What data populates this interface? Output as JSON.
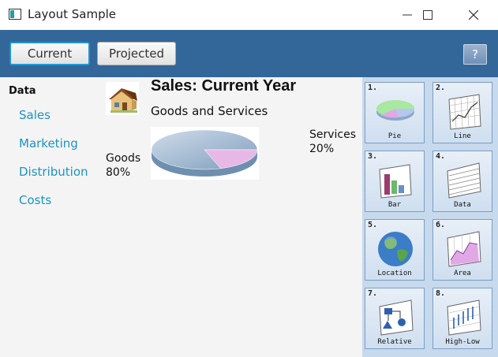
{
  "window": {
    "title": "Layout Sample"
  },
  "toolbar": {
    "current_label": "Current",
    "projected_label": "Projected",
    "help_label": "?"
  },
  "sidebar": {
    "title": "Data",
    "items": [
      {
        "label": "Sales"
      },
      {
        "label": "Marketing"
      },
      {
        "label": "Distribution"
      },
      {
        "label": "Costs"
      }
    ]
  },
  "main": {
    "title": "Sales:  Current Year",
    "subtitle": "Goods and Services"
  },
  "chart_data": {
    "type": "pie",
    "categories": [
      "Goods",
      "Services"
    ],
    "values": [
      80,
      20
    ],
    "labels": [
      {
        "line1": "Goods",
        "line2": "80%"
      },
      {
        "line1": "Services",
        "line2": "20%"
      }
    ],
    "colors": [
      "#a9c1d8",
      "#e7b8e6"
    ]
  },
  "tiles": [
    {
      "number": "1.",
      "label": "Pie"
    },
    {
      "number": "2.",
      "label": "Line"
    },
    {
      "number": "3.",
      "label": "Bar"
    },
    {
      "number": "4.",
      "label": "Data"
    },
    {
      "number": "5.",
      "label": "Location"
    },
    {
      "number": "6.",
      "label": "Area"
    },
    {
      "number": "7.",
      "label": "Relative"
    },
    {
      "number": "8.",
      "label": "High-Low"
    }
  ],
  "icons": {
    "window": "app-window-icon",
    "house": "house-icon",
    "minimize": "minimize-icon",
    "maximize": "maximize-icon",
    "close": "close-icon"
  }
}
